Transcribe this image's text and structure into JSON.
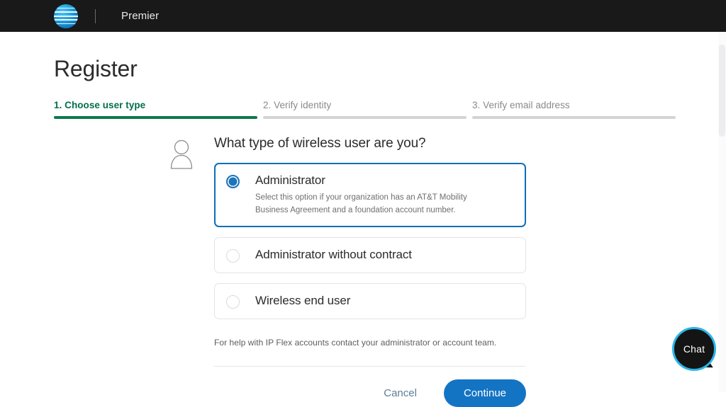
{
  "header": {
    "logo_name": "att-globe-logo",
    "brand": "Premier"
  },
  "page": {
    "title": "Register"
  },
  "stepper": {
    "steps": [
      {
        "label": "1. Choose user type",
        "state": "active"
      },
      {
        "label": "2. Verify identity",
        "state": "inactive"
      },
      {
        "label": "3. Verify email address",
        "state": "inactive"
      }
    ]
  },
  "form": {
    "avatar_icon": "person-icon",
    "question": "What type of wireless user are you?",
    "options": [
      {
        "title": "Administrator",
        "description": "Select this option if your organization has an AT&T Mobility Business Agreement and a foundation account number.",
        "selected": true
      },
      {
        "title": "Administrator without contract",
        "description": "",
        "selected": false
      },
      {
        "title": "Wireless end user",
        "description": "",
        "selected": false
      }
    ],
    "help_text": "For help with IP Flex accounts contact your administrator or account team."
  },
  "actions": {
    "cancel_label": "Cancel",
    "continue_label": "Continue"
  },
  "chat": {
    "label": "Chat"
  },
  "colors": {
    "header_bg": "#191919",
    "step_active": "#00704a",
    "step_bar_active": "#0a7a4e",
    "step_bar_inactive": "#d4d4d4",
    "selected_border": "#0d6fb8",
    "radio_selected": "#1b75bb",
    "primary_button": "#1474c4",
    "cancel_text": "#5e7d96",
    "chat_ring": "#2ab5e8"
  }
}
